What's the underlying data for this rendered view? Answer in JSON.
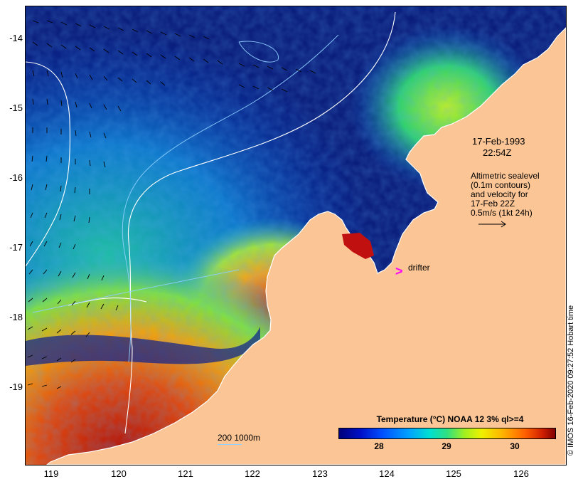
{
  "map": {
    "y_axis_labels": [
      "-14",
      "-15",
      "-16",
      "-17",
      "-18",
      "-19"
    ],
    "x_axis_labels": [
      "119",
      "120",
      "121",
      "122",
      "123",
      "124",
      "125",
      "126"
    ],
    "timestamp_line1": "17-Feb-1993",
    "timestamp_line2": "22:54Z",
    "legend_lines": [
      "Altimetric sealevel",
      "(0.1m contours)",
      "and velocity for",
      "17-Feb 22Z",
      "0.5m/s (1kt 24h)"
    ],
    "drifter_marker": ">",
    "drifter_label": "drifter",
    "contour_key": "200  1000m",
    "colorbar_title": "Temperature (°C) NOAA 12 3% ql>=4",
    "colorbar_ticks": [
      "28",
      "29",
      "30"
    ],
    "credit": "© IMOS 16-Feb-2020 09:27:52 Hobart time",
    "colors": {
      "land": "#fbc595",
      "cold_water": "#0a1d7a",
      "warm_water": "#c02010",
      "contour": "#ffffff",
      "bathy": "#8fd0ff",
      "drifter": "#ff00ff"
    }
  }
}
